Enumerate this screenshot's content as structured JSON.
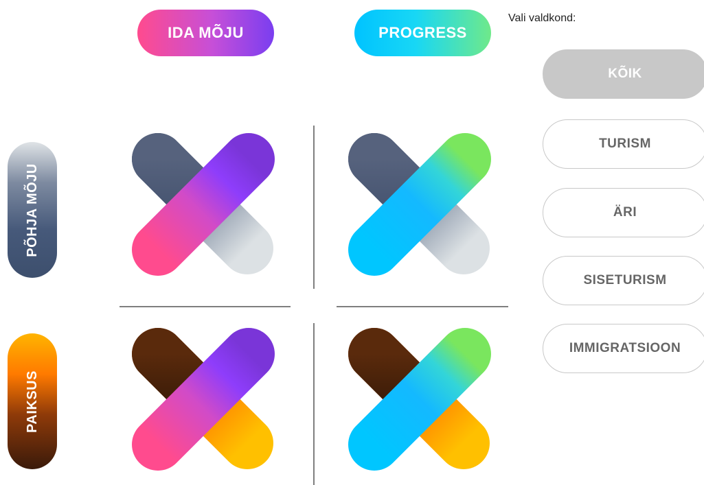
{
  "columns": {
    "ida": "IDA MÕJU",
    "progress": "PROGRESS"
  },
  "rows": {
    "pohja": "PÕHJA MÕJU",
    "paiksus": "PAIKSUS"
  },
  "filter": {
    "label": "Vali valdkond:",
    "buttons": [
      "KÕIK",
      "TURISM",
      "ÄRI",
      "SISETURISM",
      "IMMIGRATSIOON"
    ],
    "selected": "KÕIK"
  },
  "colors": {
    "ida": [
      "#ff4b8e",
      "#7a3ef0"
    ],
    "progress": [
      "#00c3ff",
      "#6fe98a"
    ],
    "pohja": [
      "#dfe3e6",
      "#3d4f6d"
    ],
    "paiksus": [
      "#ffb400",
      "#3a1a0a"
    ],
    "grid_line": "#7f7f7f",
    "filter_active": "#c8c8c8"
  }
}
